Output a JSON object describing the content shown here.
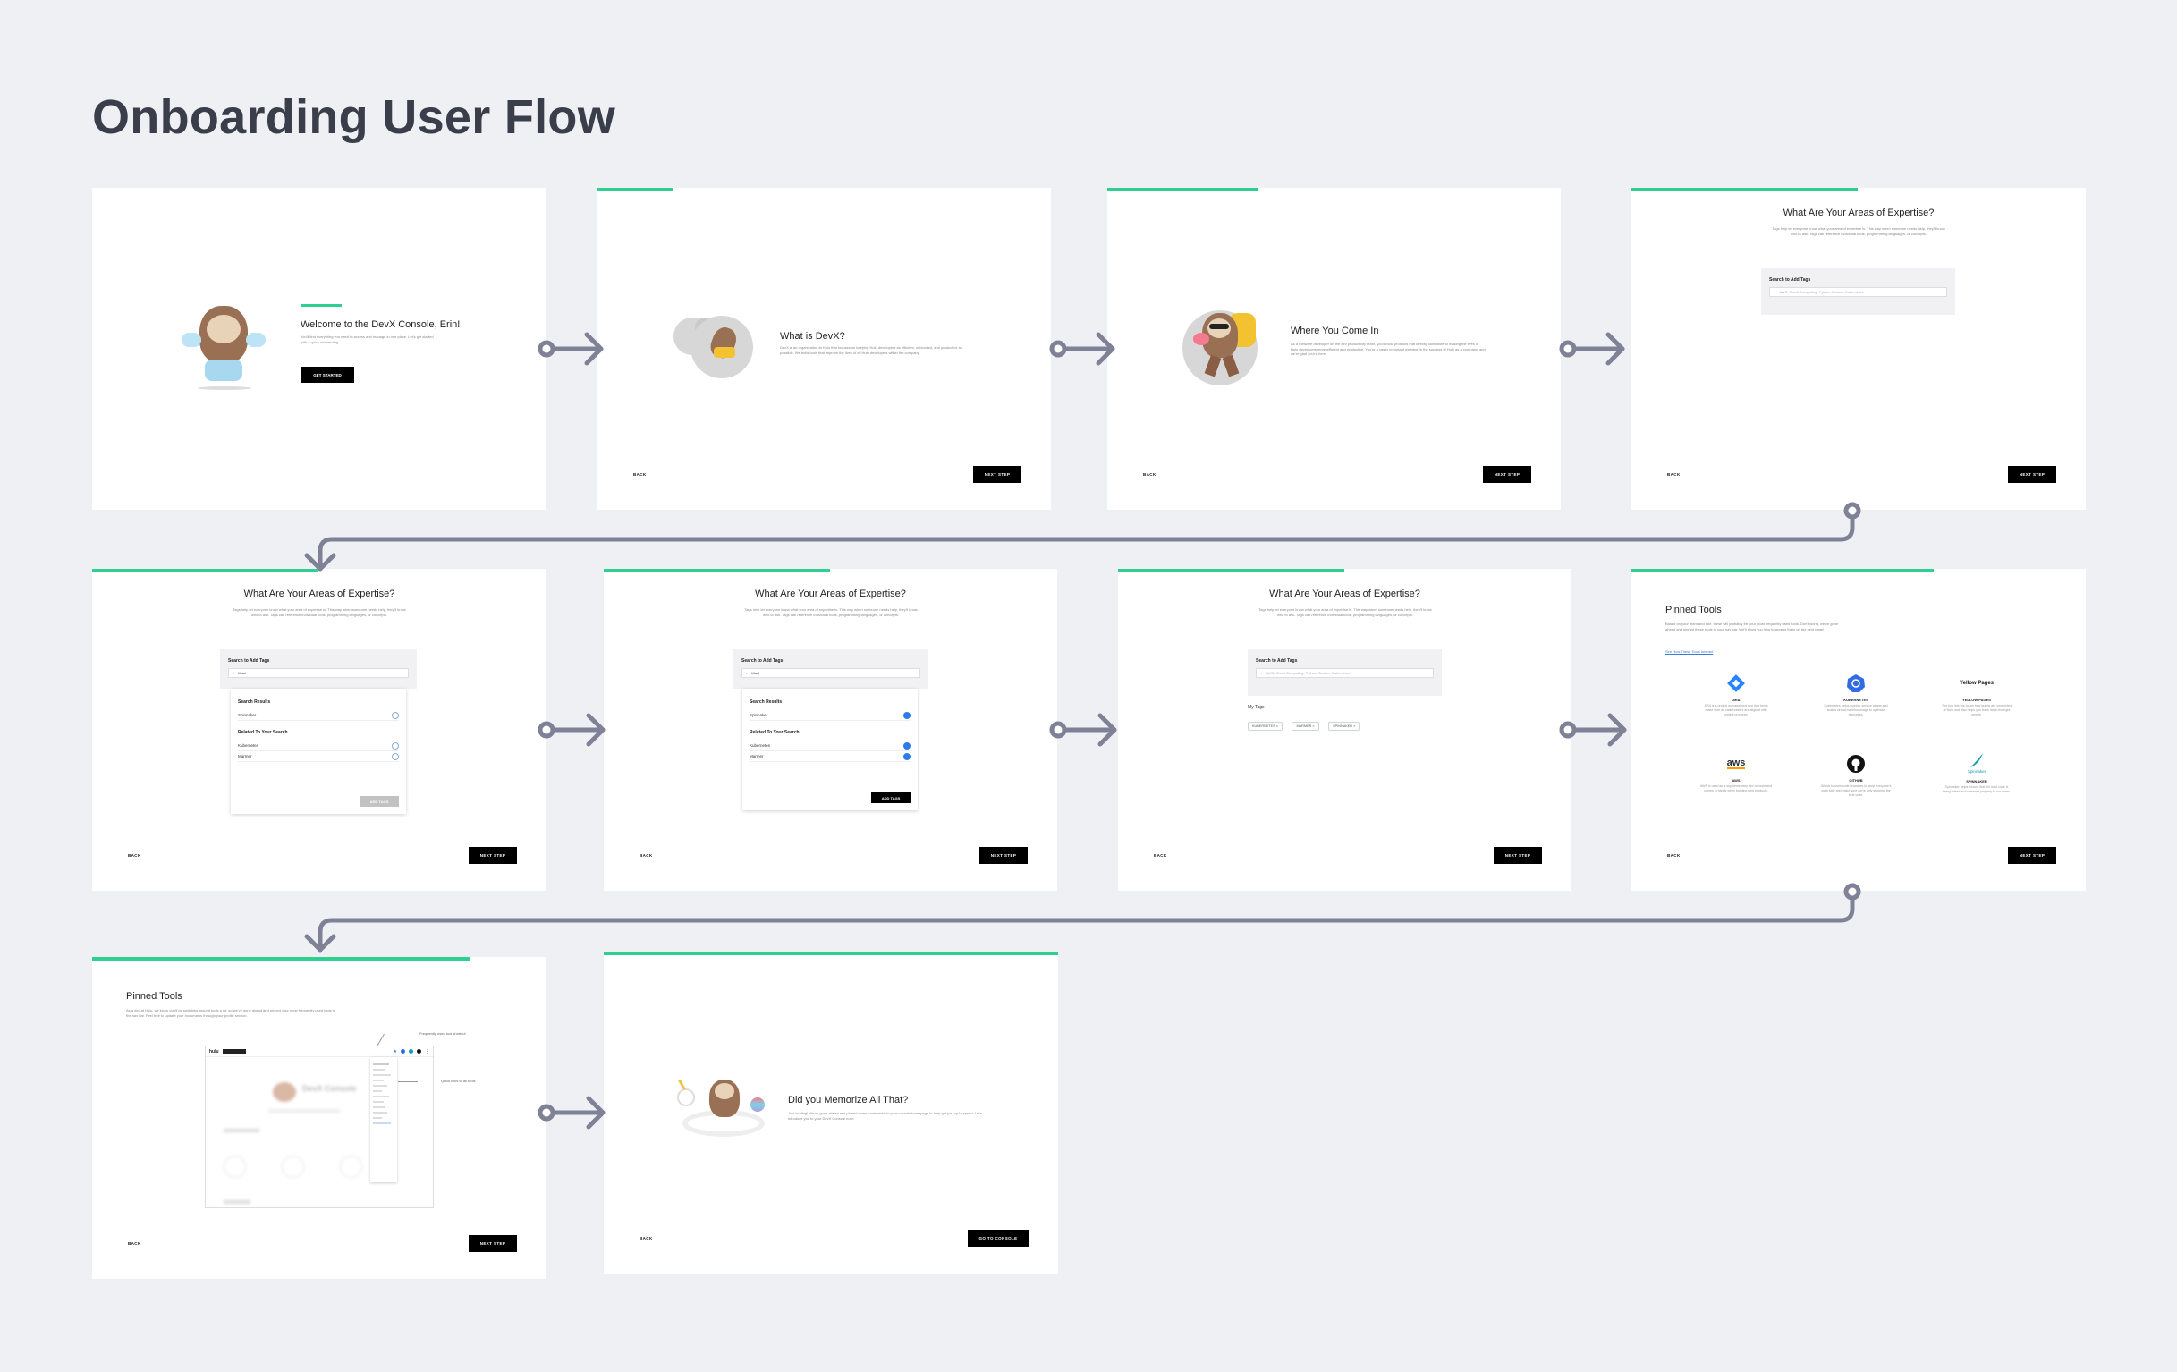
{
  "title": "Onboarding User Flow",
  "common": {
    "back": "BACK",
    "next": "NEXT STEP"
  },
  "s1": {
    "title": "Welcome to the DevX Console, Erin!",
    "body": "You'll find everything you need to access and manage in one place. Let's get started with a quick onboarding.",
    "button": "GET STARTED"
  },
  "s2": {
    "title": "What is DevX?",
    "body": "DevX is an organization at Hulu that focuses on keeping Hulu developers as efficient, unblocked, and productive as possible. We build tools that improve the lives of all Hulu developers within the company."
  },
  "s3": {
    "title": "Where You Come In",
    "body": "As a software developer on the dev productivity team, you'll build products that directly contribute to making the lives of Hulu developers more efficient and productive. You're a vastly important member in the success of Hulu as a company, and we're glad you're here."
  },
  "expertise": {
    "title": "What Are Your Areas of Expertise?",
    "body": "Tags help let everyone know what your area of expertise is. This way when someone needs help, they'll know who to ask. Tags can reference individual tools, programming languages, or concepts.",
    "search_label": "Search to Add Tags",
    "placeholder": "AWS, Cloud Computing, Python, Docker, Kubernetes",
    "query": "Mani",
    "results_hd": "Search Results",
    "related_hd": "Related To Your Search",
    "result": "Spinnaker",
    "related": [
      "Kubernetes",
      "Marmer"
    ],
    "add": "ADD TAGS",
    "my_tags": "My Tags",
    "tags": [
      "KUBERNETES",
      "MARMER",
      "SPINNAKER"
    ]
  },
  "pinned": {
    "title": "Pinned Tools",
    "body": "Based on your team and role, these will probably be your most frequently used tools. Don't worry, we've gone ahead and pinned these tools to your nav bar. We'll show you how to access them on the next page!",
    "link": "See How These Tools Interact",
    "tools": [
      {
        "name": "JIRA",
        "desc": "JIRA is a project management tool that helps make sure all stakeholders are aligned with project progress."
      },
      {
        "name": "KUBERNETES",
        "desc": "Kubernetes helps monitor service usage and scales virtual machine usage to optimize resources."
      },
      {
        "name": "YELLOW PAGES",
        "logo": "Yellow Pages",
        "desc": "The tool lets you know how teams are connected at Hulu and also helps you track down the right people."
      },
      {
        "name": "AWS",
        "logo": "aws",
        "desc": "AWS is used as a supplementary dev console and comes in handy when building new products."
      },
      {
        "name": "GITHUB",
        "desc": "Github houses code branches to keep everyone's work safe and make sure we're only shipping the best code."
      },
      {
        "name": "SPINNAKER",
        "logo": "Spinnaker",
        "desc": "Spinnaker helps ensure that the best code is being tested and released properly to our users."
      }
    ]
  },
  "pinned2": {
    "title": "Pinned Tools",
    "body": "As a dev at Hulu, we know you'll be switching around tools a lot, so we've gone ahead and pinned your most frequently used tools to the nav bar. Feel free to update your bookmarks through your profile section.",
    "annot1": "Frequently used tool shortcut",
    "annot2": "Quick links to all tools",
    "logo": "hulu",
    "console": "DevX Console"
  },
  "final": {
    "title": "Did you Memorize All That?",
    "body": "Just kidding! We've gone ahead and pinned some bookmarks to your console homepage to help get you up to speed. Let's introduce you to your DevX Console now!",
    "button": "GO TO CONSOLE"
  },
  "colors": {
    "accent": "#2fd08f",
    "background": "#eff0f4",
    "connector": "#7f8196",
    "primary_button": "#000000",
    "check": "#2f7bea"
  }
}
